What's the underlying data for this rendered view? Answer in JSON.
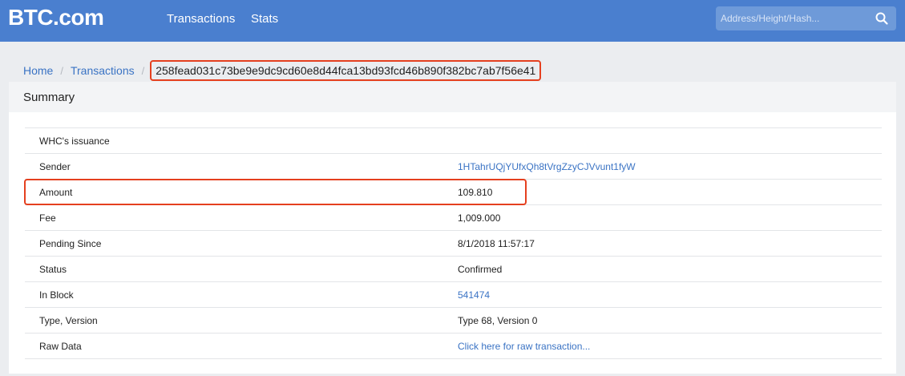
{
  "header": {
    "logo": "BTC.com",
    "nav": {
      "transactions": "Transactions",
      "stats": "Stats"
    },
    "search": {
      "placeholder": "Address/Height/Hash...",
      "value": ""
    }
  },
  "breadcrumb": {
    "home": "Home",
    "transactions": "Transactions",
    "current": "258fead031c73be9e9dc9cd60e8d44fca13bd93fcd46b890f382bc7ab7f56e41"
  },
  "summary": {
    "title": "Summary",
    "rows": [
      {
        "label": "WHC's issuance",
        "value": ""
      },
      {
        "label": "Sender",
        "value": "1HTahrUQjYUfxQh8tVrgZzyCJVvunt1fyW"
      },
      {
        "label": "Amount",
        "value": "109.810"
      },
      {
        "label": "Fee",
        "value": "1,009.000"
      },
      {
        "label": "Pending Since",
        "value": "8/1/2018 11:57:17"
      },
      {
        "label": "Status",
        "value": "Confirmed"
      },
      {
        "label": "In Block",
        "value": "541474"
      },
      {
        "label": "Type, Version",
        "value": "Type 68, Version 0"
      },
      {
        "label": "Raw Data",
        "value": "Click here for raw transaction..."
      }
    ]
  },
  "colors": {
    "header_bg": "#4a7fcf",
    "link": "#3a73c4",
    "highlight": "#e5401f"
  }
}
